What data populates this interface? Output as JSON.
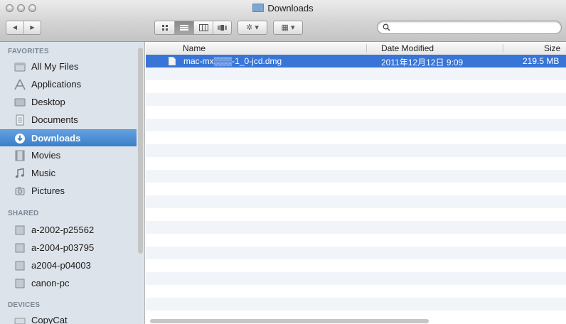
{
  "window": {
    "title": "Downloads"
  },
  "toolbar": {
    "back_glyph": "◀",
    "forward_glyph": "▶",
    "action_glyph": "✲ ▾",
    "arrange_glyph": "▦ ▾",
    "search": {
      "placeholder": "",
      "value": ""
    }
  },
  "sidebar": {
    "sections": [
      {
        "label": "FAVORITES",
        "items": [
          {
            "label": "All My Files",
            "icon": "all-files-icon"
          },
          {
            "label": "Applications",
            "icon": "applications-icon"
          },
          {
            "label": "Desktop",
            "icon": "desktop-icon"
          },
          {
            "label": "Documents",
            "icon": "documents-icon"
          },
          {
            "label": "Downloads",
            "icon": "downloads-icon",
            "selected": true
          },
          {
            "label": "Movies",
            "icon": "movies-icon"
          },
          {
            "label": "Music",
            "icon": "music-icon"
          },
          {
            "label": "Pictures",
            "icon": "pictures-icon"
          }
        ]
      },
      {
        "label": "SHARED",
        "items": [
          {
            "label": "a-2002-p25562",
            "icon": "network-computer-icon"
          },
          {
            "label": "a-2004-p03795",
            "icon": "network-computer-icon"
          },
          {
            "label": "a2004-p04003",
            "icon": "network-computer-icon"
          },
          {
            "label": "canon-pc",
            "icon": "network-computer-icon"
          }
        ]
      },
      {
        "label": "DEVICES",
        "items": [
          {
            "label": "CopyCat",
            "icon": "disk-icon"
          }
        ]
      }
    ]
  },
  "file_list": {
    "columns": {
      "name": "Name",
      "date": "Date Modified",
      "size": "Size"
    },
    "rows": [
      {
        "name": "mac-mx▒▒▒-1_0-jcd.dmg",
        "date": "2011年12月12日 9:09",
        "size": "219.5 MB",
        "selected": true
      }
    ]
  },
  "colors": {
    "selection": "#3875d7",
    "sidebar_selection": "#3a7fc9",
    "sidebar_bg": "#dde3ea",
    "stripe": "#f1f5fa"
  }
}
